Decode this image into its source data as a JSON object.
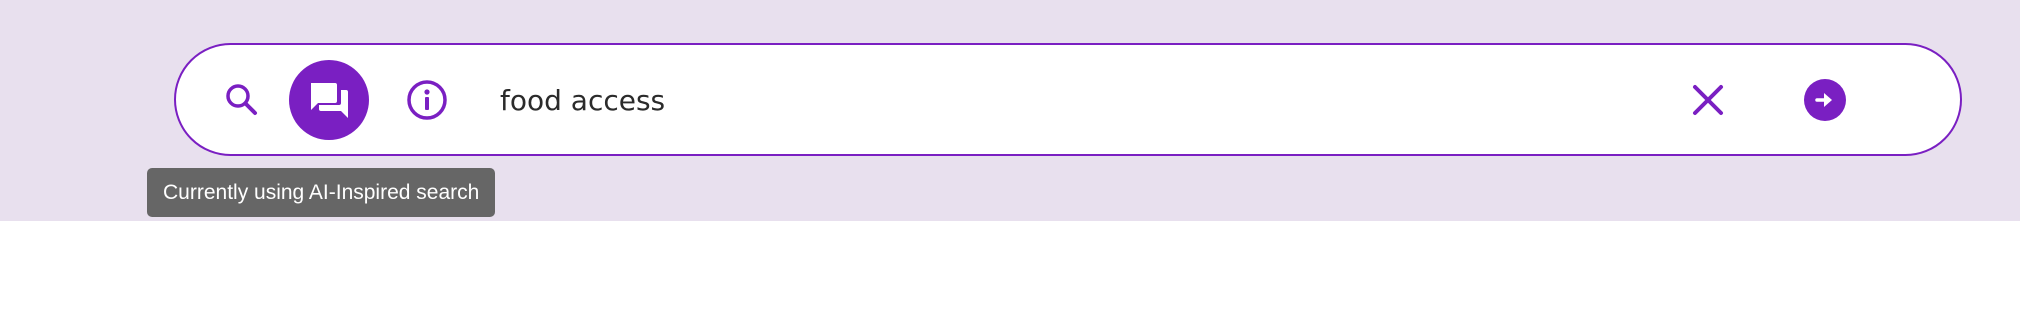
{
  "search": {
    "value": "food access",
    "placeholder": "",
    "tooltip": "Currently using AI-Inspired search"
  },
  "icons": {
    "search_mode": "search-icon",
    "ai_mode": "chat-bubbles-icon",
    "info": "info-icon",
    "clear": "close-icon",
    "submit": "arrow-right-circle-icon"
  },
  "colors": {
    "accent": "#7a1fc2",
    "band_background": "#e8e0ee",
    "tooltip_background": "#666666"
  }
}
